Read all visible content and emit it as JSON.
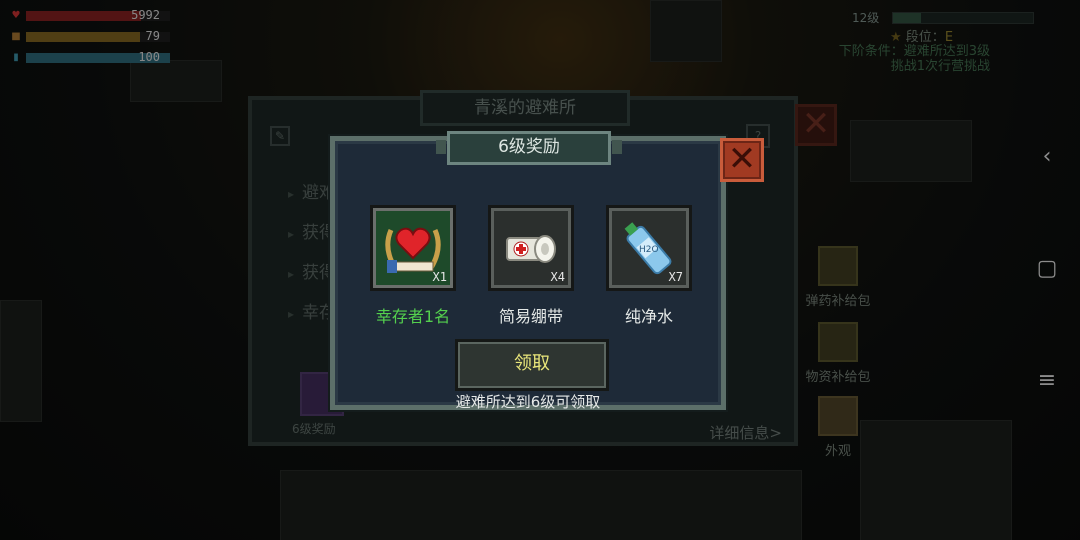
{
  "stats": {
    "health": {
      "icon": "heart-icon",
      "value": "5992",
      "color": "#b02a2a",
      "fill": 0.8
    },
    "food": {
      "icon": "food-icon",
      "value": "79",
      "color": "#b5862a",
      "fill": 0.79
    },
    "water": {
      "icon": "water-icon",
      "value": "100",
      "color": "#3a8ca0",
      "fill": 1.0
    }
  },
  "top_right": {
    "level_label": "12级",
    "level_progress": 0.2,
    "rank_label": "段位：",
    "rank_value": "E",
    "next_req_line1": "下阶条件：避难所达到3级",
    "next_req_line2": "挑战1次行营挑战"
  },
  "shortcuts": [
    {
      "label": "弹药补给包",
      "icon": "ammo-supply-icon"
    },
    {
      "label": "物资补给包",
      "icon": "material-supply-icon"
    },
    {
      "label": "外观",
      "icon": "appearance-icon"
    }
  ],
  "system_nav": {
    "back": "‹",
    "home": "▢",
    "menu": "≡"
  },
  "shelter_panel": {
    "title": "青溪的避难所",
    "rows": [
      "避难",
      "获得",
      "获得",
      "幸存"
    ],
    "gift_label": "6级奖励",
    "detail_link": "详细信息>"
  },
  "reward_dialog": {
    "title": "6级奖励",
    "items": [
      {
        "name": "幸存者1名",
        "qty": "X1",
        "icon": "survivor-heart-icon",
        "highlight": true
      },
      {
        "name": "简易绷带",
        "qty": "X4",
        "icon": "bandage-icon",
        "highlight": false
      },
      {
        "name": "纯净水",
        "qty": "X7",
        "icon": "water-bottle-icon",
        "highlight": false
      }
    ],
    "claim_label": "领取",
    "note": "避难所达到6级可领取",
    "close_symbol": "✕"
  },
  "colors": {
    "dialog_bg": "#1e2a38",
    "close_bg": "#a13a22",
    "claim_text": "#e9e67a",
    "survivor_name": "#54d04e"
  }
}
